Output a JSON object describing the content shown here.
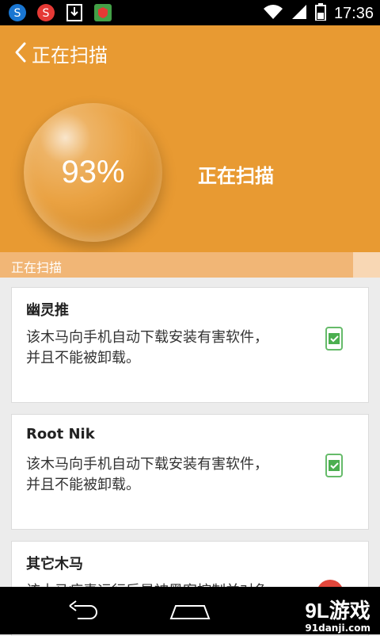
{
  "status_bar": {
    "time": "17:36",
    "notification_icons": [
      "s-logo-icon",
      "s-logo-red-icon",
      "download-icon",
      "shield-app-icon"
    ],
    "system_icons": [
      "wifi-icon",
      "signal-icon",
      "battery-icon"
    ]
  },
  "header": {
    "back_icon": "chevron-left-icon",
    "title": "正在扫描",
    "percent_text": "93%",
    "status_text": "正在扫描",
    "accent_color": "#e89a32"
  },
  "progress": {
    "label": "正在扫描",
    "value": 0.93
  },
  "cards": [
    {
      "title": "幽灵推",
      "description": "该木马向手机自动下载安装有害软件，并且不能被卸载。",
      "status_icon": "check-icon"
    },
    {
      "title": "Root Nik",
      "description": "该木马向手机自动下载安装有害软件，并且不能被卸载。",
      "status_icon": "check-icon"
    },
    {
      "title": "其它木马",
      "description": "该木马病毒运行后是被黑客控制并对免",
      "status_icon": "danger-icon"
    }
  ],
  "nav_bar": {
    "back_icon": "nav-back-icon",
    "home_icon": "nav-home-icon"
  },
  "watermark": {
    "main": "9L游戏",
    "sub": "91danji.com"
  }
}
